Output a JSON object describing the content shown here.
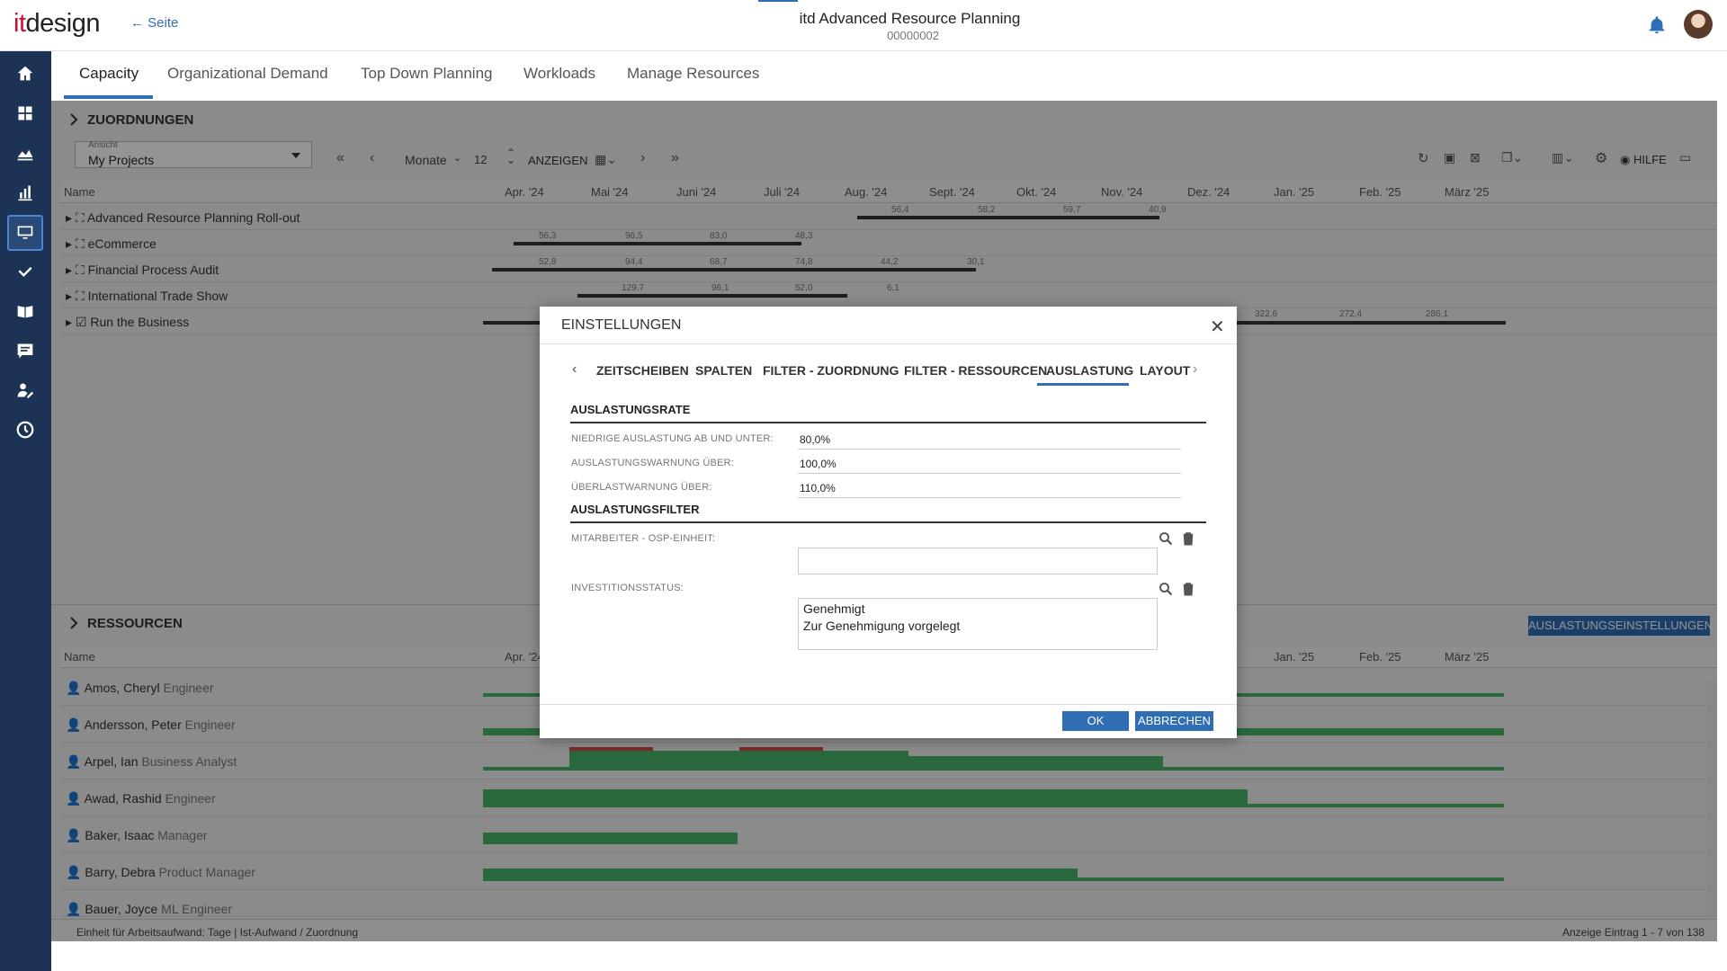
{
  "header": {
    "logo_prefix": "it",
    "logo_suffix": "design",
    "back_label": "← Seite",
    "title": "itd Advanced Resource Planning",
    "subtitle": "00000002"
  },
  "nav": [
    "home-icon",
    "dashboard-icon",
    "chart-area-icon",
    "bar-chart-icon",
    "monitor-icon",
    "check-icon",
    "book-icon",
    "list-icon",
    "user-edit-icon",
    "clock-icon"
  ],
  "tabs": [
    "Capacity",
    "Organizational Demand",
    "Top Down Planning",
    "Workloads",
    "Manage Resources"
  ],
  "zuordnungen": {
    "title": "ZUORDNUNGEN",
    "view_label": "Ansicht",
    "view_value": "My Projects",
    "period_unit": "Monate",
    "period_count": "12",
    "show_label": "ANZEIGEN",
    "help_label": "HILFE",
    "name_header": "Name",
    "months": [
      "Apr. '24",
      "Mai '24",
      "Juni '24",
      "Juli '24",
      "Aug. '24",
      "Sept. '24",
      "Okt. '24",
      "Nov. '24",
      "Dez. '24",
      "Jan. '25",
      "Feb. '25",
      "März '25"
    ],
    "rows": [
      {
        "name": "Advanced Resource Planning Roll-out",
        "values": [
          "56,4",
          "58,2",
          "59,7",
          "40,9"
        ]
      },
      {
        "name": "eCommerce",
        "values": [
          "56,3",
          "96,5",
          "83,0",
          "48,3"
        ]
      },
      {
        "name": "Financial Process Audit",
        "values": [
          "52,8",
          "94,4",
          "68,7",
          "74,8",
          "44,2",
          "30,1"
        ]
      },
      {
        "name": "International Trade Show",
        "values": [
          "129,7",
          "96,1",
          "52,0",
          "6,1"
        ]
      },
      {
        "name": "Run the Business",
        "values": [
          "322,6",
          "272,4",
          "286,1"
        ]
      }
    ]
  },
  "ressourcen": {
    "title": "RESSOURCEN",
    "settings_button": "AUSLASTUNGSEINSTELLUNGEN",
    "name_header": "Name",
    "months": [
      "Apr. '24",
      "Jan. '25",
      "Feb. '25",
      "März '25"
    ],
    "people": [
      {
        "name": "Amos, Cheryl",
        "role": "Engineer"
      },
      {
        "name": "Andersson, Peter",
        "role": "Engineer"
      },
      {
        "name": "Arpel, Ian",
        "role": "Business Analyst"
      },
      {
        "name": "Awad, Rashid",
        "role": "Engineer"
      },
      {
        "name": "Baker, Isaac",
        "role": "Manager"
      },
      {
        "name": "Barry, Debra",
        "role": "Product Manager"
      },
      {
        "name": "Bauer, Joyce",
        "role": "ML Engineer"
      }
    ],
    "status_left": "Einheit für Arbeitsaufwand: Tage | Ist-Aufwand / Zuordnung",
    "status_right": "Anzeige Eintrag 1 - 7 von 138"
  },
  "dialog": {
    "title": "EINSTELLUNGEN",
    "tabs": [
      "ZEITSCHEIBEN",
      "SPALTEN",
      "FILTER - ZUORDNUNG",
      "FILTER - RESSOURCEN",
      "AUSLASTUNG",
      "LAYOUT"
    ],
    "active_tab": "AUSLASTUNG",
    "section_rate": "AUSLASTUNGSRATE",
    "fields": [
      {
        "label": "NIEDRIGE AUSLASTUNG AB UND UNTER:",
        "value": "80,0%"
      },
      {
        "label": "AUSLASTUNGSWARNUNG ÜBER:",
        "value": "100,0%"
      },
      {
        "label": "ÜBERLASTWARNUNG ÜBER:",
        "value": "110,0%"
      }
    ],
    "section_filter": "AUSLASTUNGSFILTER",
    "filter_employee_label": "MITARBEITER - OSP-EINHEIT:",
    "filter_status_label": "INVESTITIONSSTATUS:",
    "filter_status_values": [
      "Genehmigt",
      "Zur Genehmigung vorgelegt"
    ],
    "ok": "OK",
    "cancel": "ABBRECHEN"
  },
  "colors": {
    "accent": "#2f6db5",
    "nav_bg": "#1d3355",
    "bar_green": "#49b46a",
    "warn_red": "#d44"
  }
}
